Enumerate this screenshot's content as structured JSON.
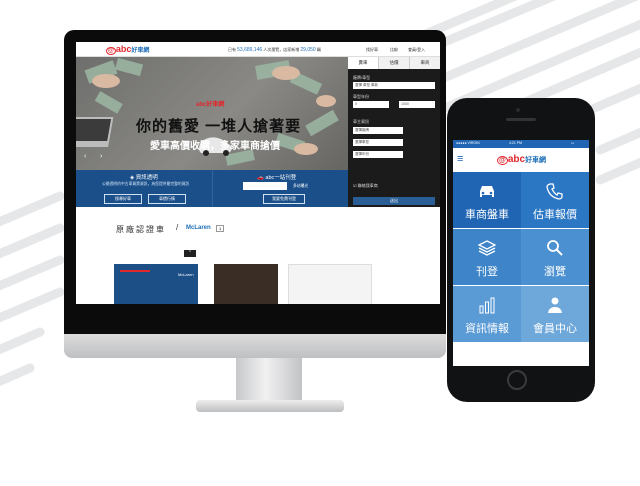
{
  "colors": {
    "brand_red": "#e0282e",
    "brand_blue": "#1f6fb8",
    "panel_blue": "#1a4f8a",
    "tile_blue_dark": "#1f65b3",
    "tile_blue": "#3d84c8",
    "tile_blue_light": "#5b9bd5"
  },
  "desktop": {
    "logo": "abc",
    "logo_sub": "好車網",
    "stats_prefix": "已有",
    "stats_members": "53,689,146",
    "stats_mid": "人次瀏覽，店家新增",
    "stats_shops": "29,050",
    "stats_suffix": "輛",
    "top_links": [
      "找好車",
      "比較",
      "會員/登入"
    ],
    "hero_brand": "abc好車網",
    "hero_title": "你的舊愛 一堆人搶著要",
    "hero_sub": "愛車高價收購，多家車商搶價",
    "panel_left_title": "資訊透明",
    "panel_left_desc": "公開透明的中古車買賣資訊，為您提供最完整的資訊",
    "panel_left_btns": [
      "搜尋好車",
      "車價行情"
    ],
    "panel_right_title": "abc一站刊登",
    "panel_right_desc": "多站曝光",
    "panel_right_btn": "我要免費刊登",
    "side_tabs": [
      "賣車",
      "估價",
      "車商"
    ],
    "side_labels": [
      "廠牌/車型",
      "車型年份",
      "車主資訊"
    ],
    "side_inputs": [
      "選擇 車型 車款",
      "0",
      "1000",
      "選擇廠牌",
      "選擇車型",
      "選擇年份"
    ],
    "side_check": "聯絡我車商",
    "side_button": "送出",
    "section_title": "原廠認證車",
    "section_brand": "McLaren",
    "section_count": "1",
    "card_label": "McLaren"
  },
  "phone": {
    "logo": "abc",
    "logo_sub": "好車網",
    "status_carrier": "●●●●● VIRGIN",
    "status_time": "4:21 PM",
    "tiles": [
      {
        "label": "車商盤車",
        "icon": "car-icon"
      },
      {
        "label": "估車報價",
        "icon": "phone-icon"
      },
      {
        "label": "刊登",
        "icon": "layers-icon"
      },
      {
        "label": "瀏覽",
        "icon": "search-icon"
      },
      {
        "label": "資訊情報",
        "icon": "bar-chart-icon"
      },
      {
        "label": "會員中心",
        "icon": "user-icon"
      }
    ]
  }
}
